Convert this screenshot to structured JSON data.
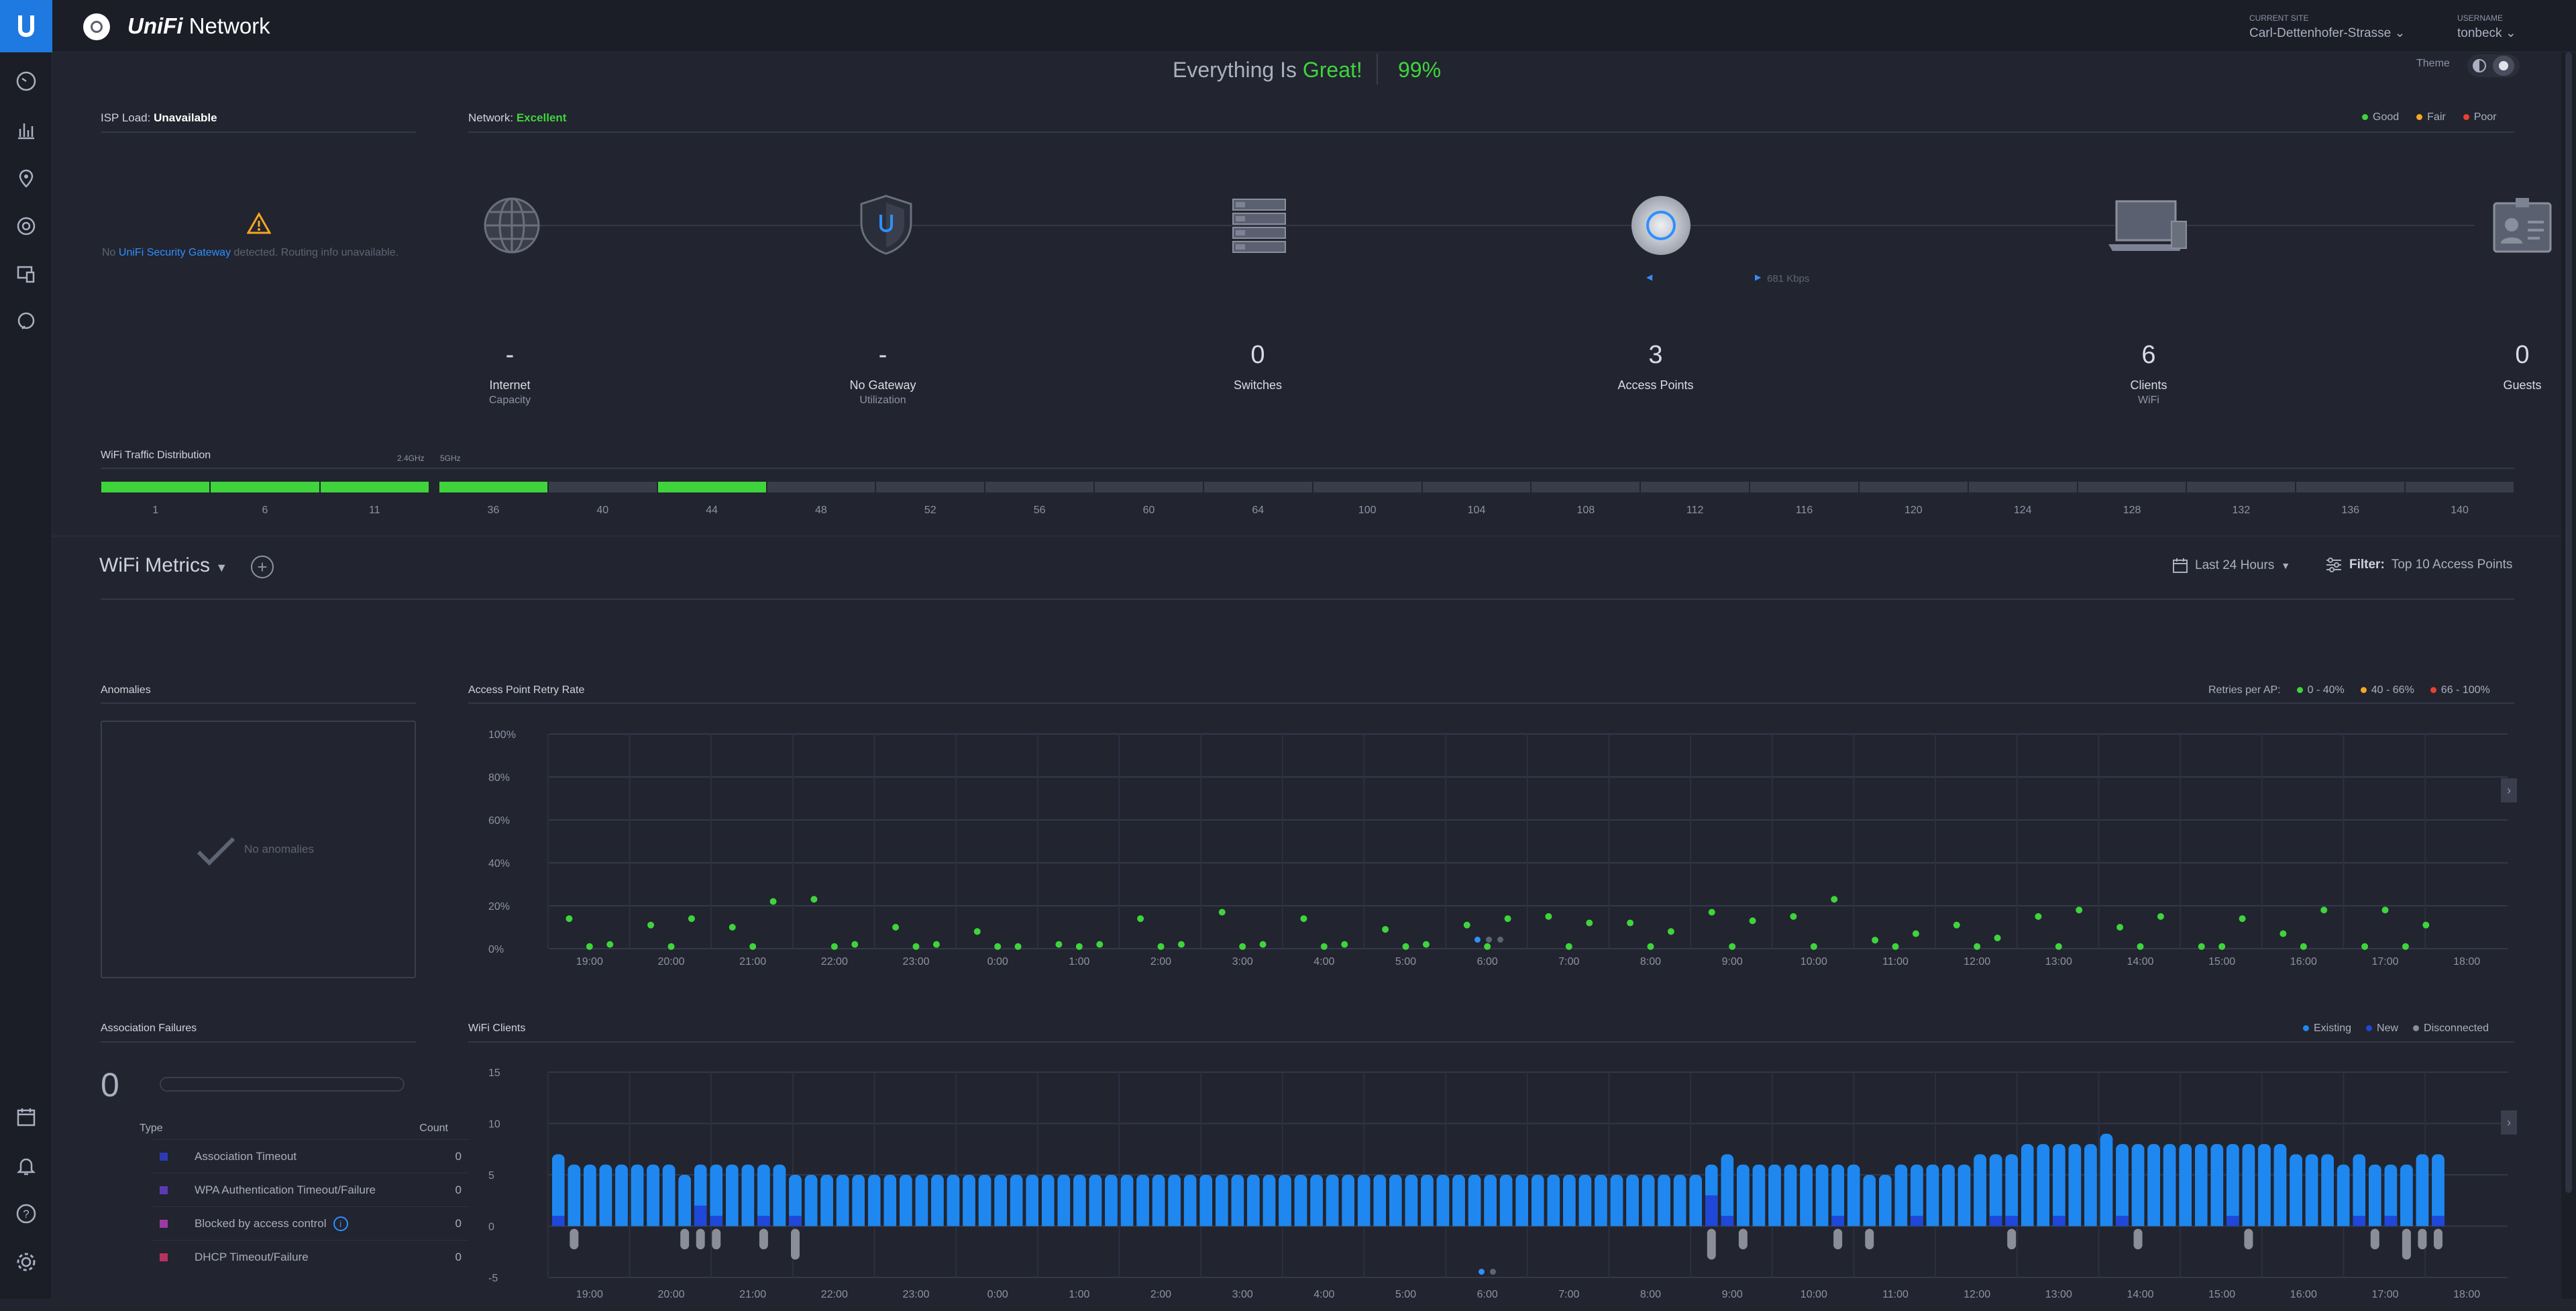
{
  "app": {
    "name": "Network",
    "brand": "UniFi"
  },
  "header": {
    "site_label": "CURRENT SITE",
    "site_value": "Carl-Dettenhofer-Strasse",
    "user_label": "USERNAME",
    "user_value": "tonbeck"
  },
  "status": {
    "text_prefix": "Everything Is",
    "text_status": "Great!",
    "percent": "99%",
    "theme_label": "Theme"
  },
  "isp": {
    "label": "ISP Load:",
    "value": "Unavailable",
    "msg_prefix": "No",
    "msg_link": "UniFi Security Gateway",
    "msg_suffix": "detected. Routing info unavailable."
  },
  "network": {
    "label": "Network:",
    "value": "Excellent",
    "legend": [
      {
        "label": "Good",
        "color": "#3fd43c"
      },
      {
        "label": "Fair",
        "color": "#f5a623"
      },
      {
        "label": "Poor",
        "color": "#e8412f"
      }
    ],
    "throughput": "681 Kbps",
    "nodes": [
      {
        "value": "-",
        "label": "Internet",
        "sublabel": "Capacity",
        "icon": "globe-icon"
      },
      {
        "value": "-",
        "label": "No Gateway",
        "sublabel": "Utilization",
        "icon": "gateway-shield-icon"
      },
      {
        "value": "0",
        "label": "Switches",
        "sublabel": "",
        "icon": "switch-icon"
      },
      {
        "value": "3",
        "label": "Access Points",
        "sublabel": "",
        "icon": "access-point-icon"
      },
      {
        "value": "6",
        "label": "Clients",
        "sublabel": "WiFi",
        "icon": "laptop-icon"
      },
      {
        "value": "0",
        "label": "Guests",
        "sublabel": "",
        "icon": "guest-badge-icon"
      }
    ]
  },
  "wifi_dist": {
    "title": "WiFi Traffic Distribution",
    "band24": "2.4GHz",
    "band5": "5GHz",
    "channels24": [
      "1",
      "6",
      "11"
    ],
    "channels5": [
      "36",
      "40",
      "44",
      "48",
      "52",
      "56",
      "60",
      "64",
      "100",
      "104",
      "108",
      "112",
      "116",
      "120",
      "124",
      "128",
      "132",
      "136",
      "140"
    ],
    "active24": [
      1,
      1,
      1
    ],
    "active5": [
      1,
      0,
      1,
      0,
      0,
      0,
      0,
      0,
      0,
      0,
      0,
      0,
      0,
      0,
      0,
      0,
      0,
      0,
      0
    ]
  },
  "metrics": {
    "title": "WiFi Metrics",
    "time_range": "Last 24 Hours",
    "filter_label": "Filter:",
    "filter_value": "Top 10 Access Points"
  },
  "anomalies": {
    "title": "Anomalies",
    "empty_text": "No anomalies"
  },
  "retry": {
    "title": "Access Point Retry Rate",
    "legend_title": "Retries per AP:",
    "legend": [
      {
        "label": "0 - 40%",
        "color": "#3fd43c"
      },
      {
        "label": "40 - 66%",
        "color": "#f5a623"
      },
      {
        "label": "66 - 100%",
        "color": "#e8412f"
      }
    ]
  },
  "assoc": {
    "title": "Association Failures",
    "total": "0",
    "col_type": "Type",
    "col_count": "Count",
    "rows": [
      {
        "type": "Association Timeout",
        "count": "0",
        "color": "#2c3bb5",
        "info": false
      },
      {
        "type": "WPA Authentication Timeout/Failure",
        "count": "0",
        "color": "#5b3ab5",
        "info": false
      },
      {
        "type": "Blocked by access control",
        "count": "0",
        "color": "#9b3aa5",
        "info": true
      },
      {
        "type": "DHCP Timeout/Failure",
        "count": "0",
        "color": "#b5325f",
        "info": false
      }
    ]
  },
  "clients": {
    "title": "WiFi Clients",
    "legend": [
      {
        "label": "Existing",
        "color": "#1e88f0"
      },
      {
        "label": "New",
        "color": "#1f47d9"
      },
      {
        "label": "Disconnected",
        "color": "#8a8e99"
      }
    ]
  },
  "chart_data": [
    {
      "type": "scatter",
      "title": "Access Point Retry Rate",
      "x_ticks": [
        "19:00",
        "20:00",
        "21:00",
        "22:00",
        "23:00",
        "0:00",
        "1:00",
        "2:00",
        "3:00",
        "4:00",
        "5:00",
        "6:00",
        "7:00",
        "8:00",
        "9:00",
        "10:00",
        "11:00",
        "12:00",
        "13:00",
        "14:00",
        "15:00",
        "16:00",
        "17:00",
        "18:00"
      ],
      "y_ticks": [
        "100%",
        "80%",
        "60%",
        "40%",
        "20%",
        "0%"
      ],
      "ylim": [
        0,
        100
      ],
      "series": [
        {
          "name": "0 - 40%",
          "points": [
            [
              18.75,
              14
            ],
            [
              19.0,
              1
            ],
            [
              19.25,
              2
            ],
            [
              19.75,
              11
            ],
            [
              20.0,
              1
            ],
            [
              20.25,
              14
            ],
            [
              20.75,
              10
            ],
            [
              21.0,
              1
            ],
            [
              21.25,
              22
            ],
            [
              21.75,
              23
            ],
            [
              22.0,
              1
            ],
            [
              22.25,
              2
            ],
            [
              22.75,
              10
            ],
            [
              23.0,
              1
            ],
            [
              23.25,
              2
            ],
            [
              23.75,
              8
            ],
            [
              24.0,
              1
            ],
            [
              24.25,
              1
            ],
            [
              24.75,
              2
            ],
            [
              25.0,
              1
            ],
            [
              25.25,
              2
            ],
            [
              25.75,
              14
            ],
            [
              26.0,
              1
            ],
            [
              26.25,
              2
            ],
            [
              26.75,
              17
            ],
            [
              27.0,
              1
            ],
            [
              27.25,
              2
            ],
            [
              27.75,
              14
            ],
            [
              28.0,
              1
            ],
            [
              28.25,
              2
            ],
            [
              28.75,
              9
            ],
            [
              29.0,
              1
            ],
            [
              29.25,
              2
            ],
            [
              29.75,
              11
            ],
            [
              30.0,
              1
            ],
            [
              30.25,
              14
            ],
            [
              30.75,
              15
            ],
            [
              31.0,
              1
            ],
            [
              31.25,
              12
            ],
            [
              31.75,
              12
            ],
            [
              32.0,
              1
            ],
            [
              32.25,
              8
            ],
            [
              32.75,
              17
            ],
            [
              33.0,
              1
            ],
            [
              33.25,
              13
            ],
            [
              33.75,
              15
            ],
            [
              34.0,
              1
            ],
            [
              34.25,
              23
            ],
            [
              34.75,
              4
            ],
            [
              35.0,
              1
            ],
            [
              35.25,
              7
            ],
            [
              35.75,
              11
            ],
            [
              36.0,
              1
            ],
            [
              36.25,
              5
            ],
            [
              36.75,
              15
            ],
            [
              37.0,
              1
            ],
            [
              37.25,
              18
            ],
            [
              37.75,
              10
            ],
            [
              38.0,
              1
            ],
            [
              38.25,
              15
            ],
            [
              38.75,
              1
            ],
            [
              39.0,
              1
            ],
            [
              39.25,
              14
            ],
            [
              39.75,
              7
            ],
            [
              40.0,
              1
            ],
            [
              40.25,
              18
            ],
            [
              40.75,
              1
            ],
            [
              41.0,
              18
            ],
            [
              41.25,
              1
            ],
            [
              41.5,
              11
            ]
          ]
        }
      ]
    },
    {
      "type": "bar",
      "title": "WiFi Clients",
      "x_ticks": [
        "19:00",
        "20:00",
        "21:00",
        "22:00",
        "23:00",
        "0:00",
        "1:00",
        "2:00",
        "3:00",
        "4:00",
        "5:00",
        "6:00",
        "7:00",
        "8:00",
        "9:00",
        "10:00",
        "11:00",
        "12:00",
        "13:00",
        "14:00",
        "15:00",
        "16:00",
        "17:00",
        "18:00"
      ],
      "y_ticks": [
        "15",
        "10",
        "5",
        "0",
        "-5"
      ],
      "ylim": [
        -5,
        15
      ],
      "series": [
        {
          "name": "Existing",
          "values": [
            7,
            6,
            6,
            6,
            6,
            6,
            6,
            6,
            5,
            6,
            6,
            6,
            6,
            6,
            6,
            5,
            5,
            5,
            5,
            5,
            5,
            5,
            5,
            5,
            5,
            5,
            5,
            5,
            5,
            5,
            5,
            5,
            5,
            5,
            5,
            5,
            5,
            5,
            5,
            5,
            5,
            5,
            5,
            5,
            5,
            5,
            5,
            5,
            5,
            5,
            5,
            5,
            5,
            5,
            5,
            5,
            5,
            5,
            5,
            5,
            5,
            5,
            5,
            5,
            5,
            5,
            5,
            5,
            5,
            5,
            5,
            5,
            5,
            6,
            7,
            6,
            6,
            6,
            6,
            6,
            6,
            6,
            6,
            5,
            5,
            6,
            6,
            6,
            6,
            6,
            7,
            7,
            7,
            8,
            8,
            8,
            8,
            8,
            9,
            8,
            8,
            8,
            8,
            8,
            8,
            8,
            8,
            8,
            8,
            8,
            7,
            7,
            7,
            6,
            7,
            6,
            6,
            6,
            7,
            7
          ]
        },
        {
          "name": "New",
          "values": [
            1,
            0,
            0,
            0,
            0,
            0,
            0,
            0,
            0,
            2,
            1,
            0,
            0,
            1,
            0,
            1,
            0,
            0,
            0,
            0,
            0,
            0,
            0,
            0,
            0,
            0,
            0,
            0,
            0,
            0,
            0,
            0,
            0,
            0,
            0,
            0,
            0,
            0,
            0,
            0,
            0,
            0,
            0,
            0,
            0,
            0,
            0,
            0,
            0,
            0,
            0,
            0,
            0,
            0,
            0,
            0,
            0,
            0,
            0,
            0,
            0,
            0,
            0,
            0,
            0,
            0,
            0,
            0,
            0,
            0,
            0,
            0,
            0,
            3,
            1,
            0,
            0,
            0,
            0,
            0,
            0,
            1,
            0,
            0,
            0,
            0,
            1,
            0,
            0,
            0,
            0,
            1,
            1,
            0,
            0,
            1,
            0,
            0,
            0,
            1,
            0,
            0,
            0,
            0,
            0,
            0,
            1,
            0,
            0,
            0,
            0,
            0,
            0,
            0,
            1,
            0,
            1,
            0,
            0,
            1
          ]
        },
        {
          "name": "Disconnected",
          "values": [
            0,
            2,
            0,
            0,
            0,
            0,
            0,
            0,
            2,
            2,
            2,
            0,
            0,
            2,
            0,
            3,
            0,
            0,
            0,
            0,
            0,
            0,
            0,
            0,
            0,
            0,
            0,
            0,
            0,
            0,
            0,
            0,
            0,
            0,
            0,
            0,
            0,
            0,
            0,
            0,
            0,
            0,
            0,
            0,
            0,
            0,
            0,
            0,
            0,
            0,
            0,
            0,
            0,
            0,
            0,
            0,
            0,
            0,
            0,
            0,
            0,
            0,
            0,
            0,
            0,
            0,
            0,
            0,
            0,
            0,
            0,
            0,
            0,
            3,
            0,
            2,
            0,
            0,
            0,
            0,
            0,
            2,
            0,
            2,
            0,
            0,
            0,
            0,
            0,
            0,
            0,
            0,
            2,
            0,
            0,
            0,
            0,
            0,
            0,
            0,
            2,
            0,
            0,
            0,
            0,
            0,
            0,
            2,
            0,
            0,
            0,
            0,
            0,
            0,
            0,
            2,
            0,
            3,
            2,
            2
          ]
        }
      ]
    }
  ]
}
